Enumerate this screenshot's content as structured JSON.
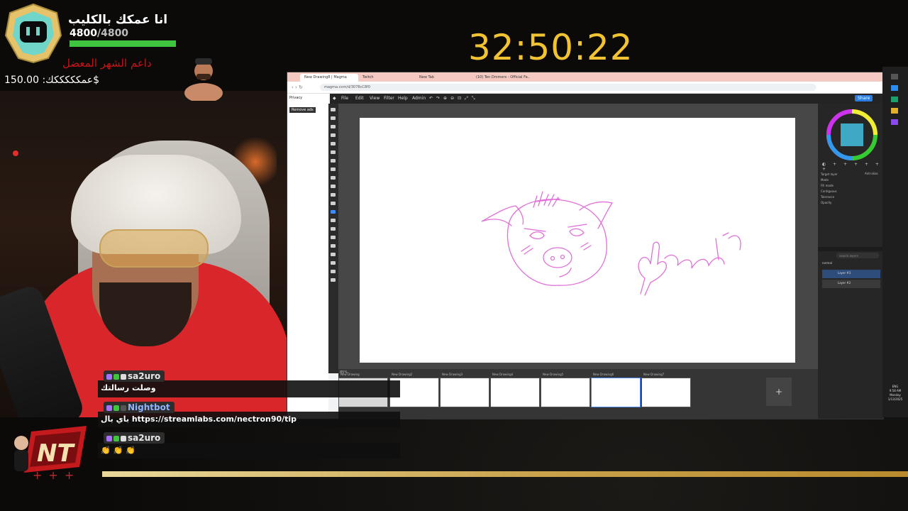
{
  "overlay": {
    "subscriber_goal_title": "انا عمكك بالكليب",
    "subscriber_count": "4800",
    "subscriber_total": "/4800",
    "subscriber_progress": 1.0,
    "top_supporter": "داعم الشهر المعضل",
    "supporter_amount": "عمكككككك: 150.00$",
    "timer": "32:50:22"
  },
  "browser": {
    "tabs": [
      {
        "label": "New Drawing8 | Magma"
      },
      {
        "label": "Twitch"
      },
      {
        "label": "New Tab"
      },
      {
        "label": "(10) Ten Dmmers - Official Fa..."
      }
    ],
    "url": "magma.com/d/3078cC8f0"
  },
  "app": {
    "menu": [
      "File",
      "Edit",
      "View",
      "Filter",
      "Help",
      "Admin"
    ],
    "left_panel": {
      "privacy": "Privacy",
      "remove_ads": "Remove ads"
    },
    "share_label": "Share",
    "zoom": "85%",
    "drawings": [
      {
        "label": "New Drawing"
      },
      {
        "label": "New Drawing2"
      },
      {
        "label": "New Drawing3"
      },
      {
        "label": "New Drawing4"
      },
      {
        "label": "New Drawing5"
      },
      {
        "label": "New Drawing6"
      },
      {
        "label": "New Drawing7"
      }
    ],
    "add_label": "+",
    "layers": {
      "search_placeholder": "search layers",
      "mode": "normal",
      "items": [
        {
          "name": "Layer #3",
          "selected": true
        },
        {
          "name": "Layer #2",
          "selected": false
        }
      ]
    },
    "tool_options": {
      "target_layer": "Target layer",
      "mode": "Mode",
      "fill_mode": "Fill mode",
      "contiguous": "Contiguous",
      "anti_alias": "Anti-alias",
      "tolerance": "Tolerance",
      "opacity": "Opacity"
    },
    "pen_color": "#e070d8"
  },
  "system": {
    "time": "9:58 AM",
    "day": "Monday",
    "date": "1/13/2025",
    "lang": "ENG"
  },
  "chat": [
    {
      "user": "sa2uro",
      "message": "وصلت رسالتك"
    },
    {
      "user": "Nightbot",
      "message": "باي بال https://streamlabs.com/nectron90/tip"
    },
    {
      "user": "sa2uro",
      "message": "👏 👏 👏"
    }
  ],
  "branding": {
    "logo_text": "NT",
    "plus": "+++"
  }
}
